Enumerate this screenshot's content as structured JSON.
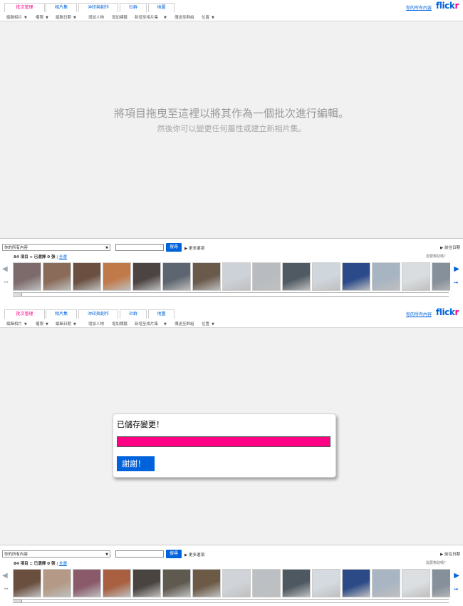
{
  "tabs": [
    "批次管理",
    "相片集",
    "沖印與創作",
    "社群",
    "地圖"
  ],
  "brand": {
    "link": "你的所有內容",
    "logo_main": "flick",
    "logo_r": "r"
  },
  "toolbar": [
    "編輯相片",
    "權限",
    "編輯日期",
    "增加人物",
    "增加標籤",
    "新增至相片集",
    "傳送至群組",
    "位置"
  ],
  "dropzone": {
    "line1": "將項目拖曳至這裡以將其作為一個批次進行編輯。",
    "line2": "然後你可以變更任何屬性或建立新相片集。"
  },
  "bottom": {
    "select_value": "你的所有內容",
    "search_button": "搜尋",
    "more_options": "更多選項",
    "goto_date": "前往日期",
    "status": "84 項目 :: 已選擇 0 張",
    "select_all": "全選",
    "help": "需要幫助嗎？"
  },
  "thumbs_panel1": [
    "#7d6a6a",
    "#8a6a58",
    "#6b5042",
    "#c07a4a",
    "#4c4442",
    "#5d6670",
    "#6a5a4c",
    "#cdd2d8",
    "#b8bcc0",
    "#4f5a62",
    "#cfd6dc",
    "#2a4a8a",
    "#a7b4c2",
    "#d9dde0",
    "#86909a"
  ],
  "thumbs_panel2": [
    "#6a4e3e",
    "#b49a86",
    "#8a5a6a",
    "#a86040",
    "#4a4440",
    "#5e5a50",
    "#6c5a46",
    "#d0d4d8",
    "#bcc0c4",
    "#4d5861",
    "#d4dae0",
    "#2c4a86",
    "#a9b5c2",
    "#dbdfe2",
    "#86909a"
  ],
  "dialog": {
    "title": "已儲存變更！",
    "bar_color": "#ff0084",
    "button": "謝謝！"
  },
  "colors": {
    "accent": "#0063dc",
    "brand_pink": "#ff0084"
  }
}
